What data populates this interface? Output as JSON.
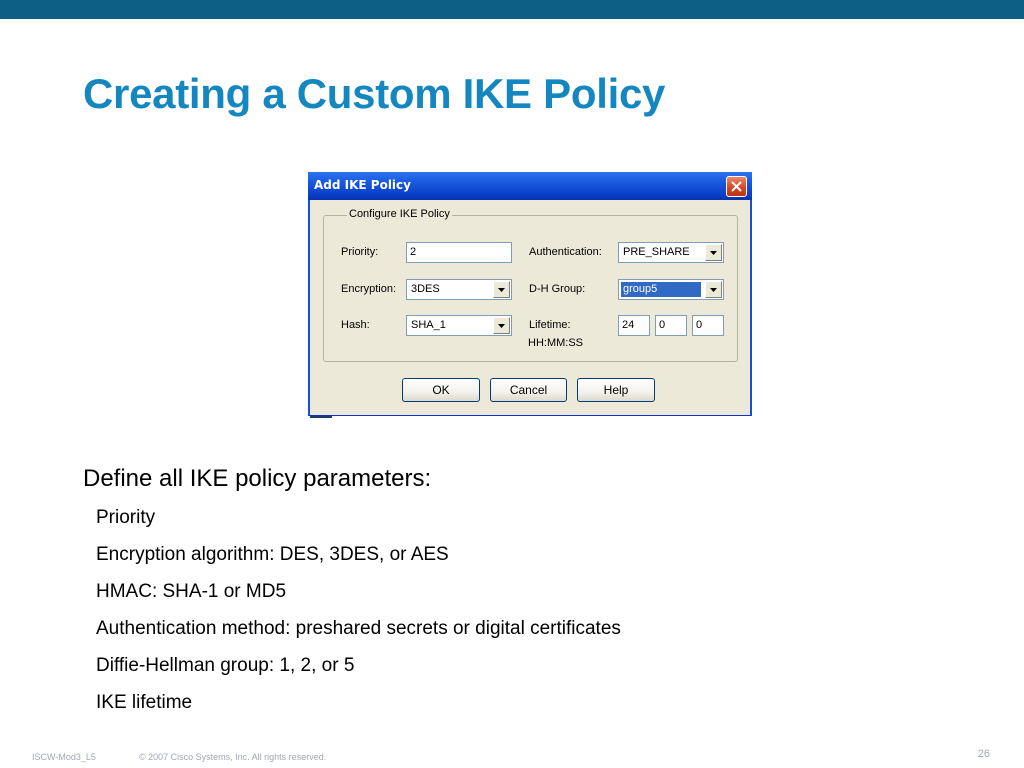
{
  "slide": {
    "title": "Creating a Custom IKE Policy",
    "intro": "Define all IKE policy parameters:",
    "bullets": [
      "Priority",
      "Encryption algorithm: DES, 3DES, or AES",
      "HMAC: SHA-1 or MD5",
      "Authentication method: preshared secrets or digital certificates",
      "Diffie-Hellman group: 1, 2, or 5",
      "IKE lifetime"
    ]
  },
  "dialog": {
    "title": "Add IKE Policy",
    "group_label": "Configure IKE Policy",
    "priority": {
      "label": "Priority:",
      "value": "2"
    },
    "encryption": {
      "label": "Encryption:",
      "value": "3DES"
    },
    "hash": {
      "label": "Hash:",
      "value": "SHA_1"
    },
    "authentication": {
      "label": "Authentication:",
      "value": "PRE_SHARE"
    },
    "dh_group": {
      "label": "D-H Group:",
      "value": "group5"
    },
    "lifetime": {
      "label": "Lifetime:",
      "hours": "24",
      "minutes": "0",
      "seconds": "0",
      "format_hint": "HH:MM:SS"
    },
    "buttons": {
      "ok": "OK",
      "cancel": "Cancel",
      "help": "Help"
    }
  },
  "footer": {
    "course_code": "ISCW-Mod3_L5",
    "copyright": "© 2007 Cisco Systems, Inc. All rights reserved.",
    "page_number": "26"
  },
  "colors": {
    "title_blue": "#1587c0",
    "top_bar": "#0e5f86",
    "dialog_face": "#ece9d8",
    "titlebar_blue": "#0a3fc8",
    "selection": "#316ac5"
  }
}
